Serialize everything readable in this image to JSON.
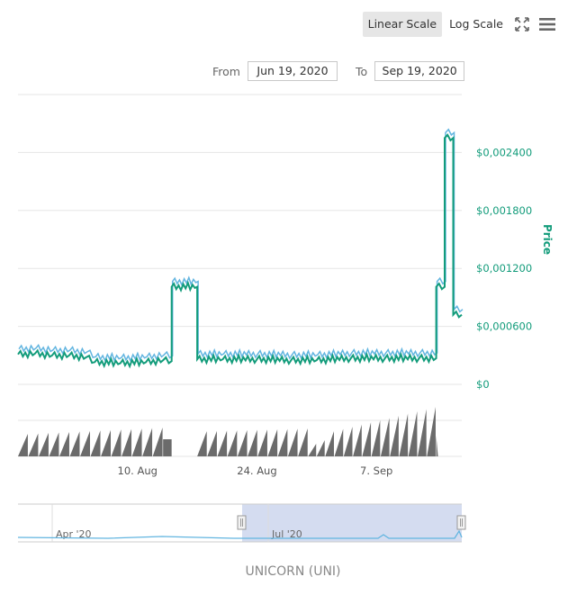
{
  "toolbar": {
    "linear_label": "Linear Scale",
    "log_label": "Log Scale",
    "active_scale": "linear",
    "fullscreen_icon": "fullscreen-icon",
    "menu_icon": "menu-icon"
  },
  "range": {
    "from_label": "From",
    "from_value": "Jun 19, 2020",
    "to_label": "To",
    "to_value": "Sep 19, 2020"
  },
  "footer": {
    "credit": "UNICORN (UNI)"
  },
  "colors": {
    "price_line": "#139c7b",
    "price_line_light": "#62b5e0",
    "volume": "#6b6b6b",
    "axis_text": "#139c7b",
    "grid": "#e6e6e6",
    "navigator_mask": "#d4dcf0",
    "navigator_line": "#62b5e0"
  },
  "chart_data": {
    "type": "line",
    "title": "",
    "ylabel": "Price",
    "y_ticks": [
      "$0",
      "$0,000600",
      "$0,001200",
      "$0,001800",
      "$0,002400"
    ],
    "ylim": [
      0,
      0.003
    ],
    "x_ticks": [
      "10. Aug",
      "24. Aug",
      "7. Sep"
    ],
    "xlim": [
      "2020-07-27",
      "2020-09-17"
    ],
    "navigator_ticks": [
      "Apr '20",
      "Jul '20"
    ],
    "grid": true,
    "legend": "none",
    "series": [
      {
        "values": [
          [
            "2020-07-27",
            0.00031
          ],
          [
            "2020-07-29",
            0.00032
          ],
          [
            "2020-07-31",
            0.0003
          ],
          [
            "2020-08-02",
            0.0003
          ],
          [
            "2020-08-04",
            0.00028
          ],
          [
            "2020-08-05",
            0.00023
          ],
          [
            "2020-08-08",
            0.00022
          ],
          [
            "2020-08-11",
            0.00023
          ],
          [
            "2020-08-13",
            0.00025
          ],
          [
            "2020-08-14",
            0.00024
          ],
          [
            "2020-08-14",
            0.00101
          ],
          [
            "2020-08-17",
            0.00101
          ],
          [
            "2020-08-17",
            0.00026
          ],
          [
            "2020-08-20",
            0.00026
          ],
          [
            "2020-08-24",
            0.00026
          ],
          [
            "2020-08-28",
            0.00025
          ],
          [
            "2020-08-31",
            0.00025
          ],
          [
            "2020-09-04",
            0.00027
          ],
          [
            "2020-09-08",
            0.00027
          ],
          [
            "2020-09-12",
            0.00027
          ],
          [
            "2020-09-14",
            0.00027
          ],
          [
            "2020-09-14",
            0.00101
          ],
          [
            "2020-09-14",
            0.00029
          ],
          [
            "2020-09-14",
            0.00101
          ],
          [
            "2020-09-15",
            0.00101
          ],
          [
            "2020-09-15",
            0.00255
          ],
          [
            "2020-09-16",
            0.00255
          ],
          [
            "2020-09-16",
            0.00072
          ],
          [
            "2020-09-17",
            0.00072
          ]
        ]
      }
    ]
  }
}
